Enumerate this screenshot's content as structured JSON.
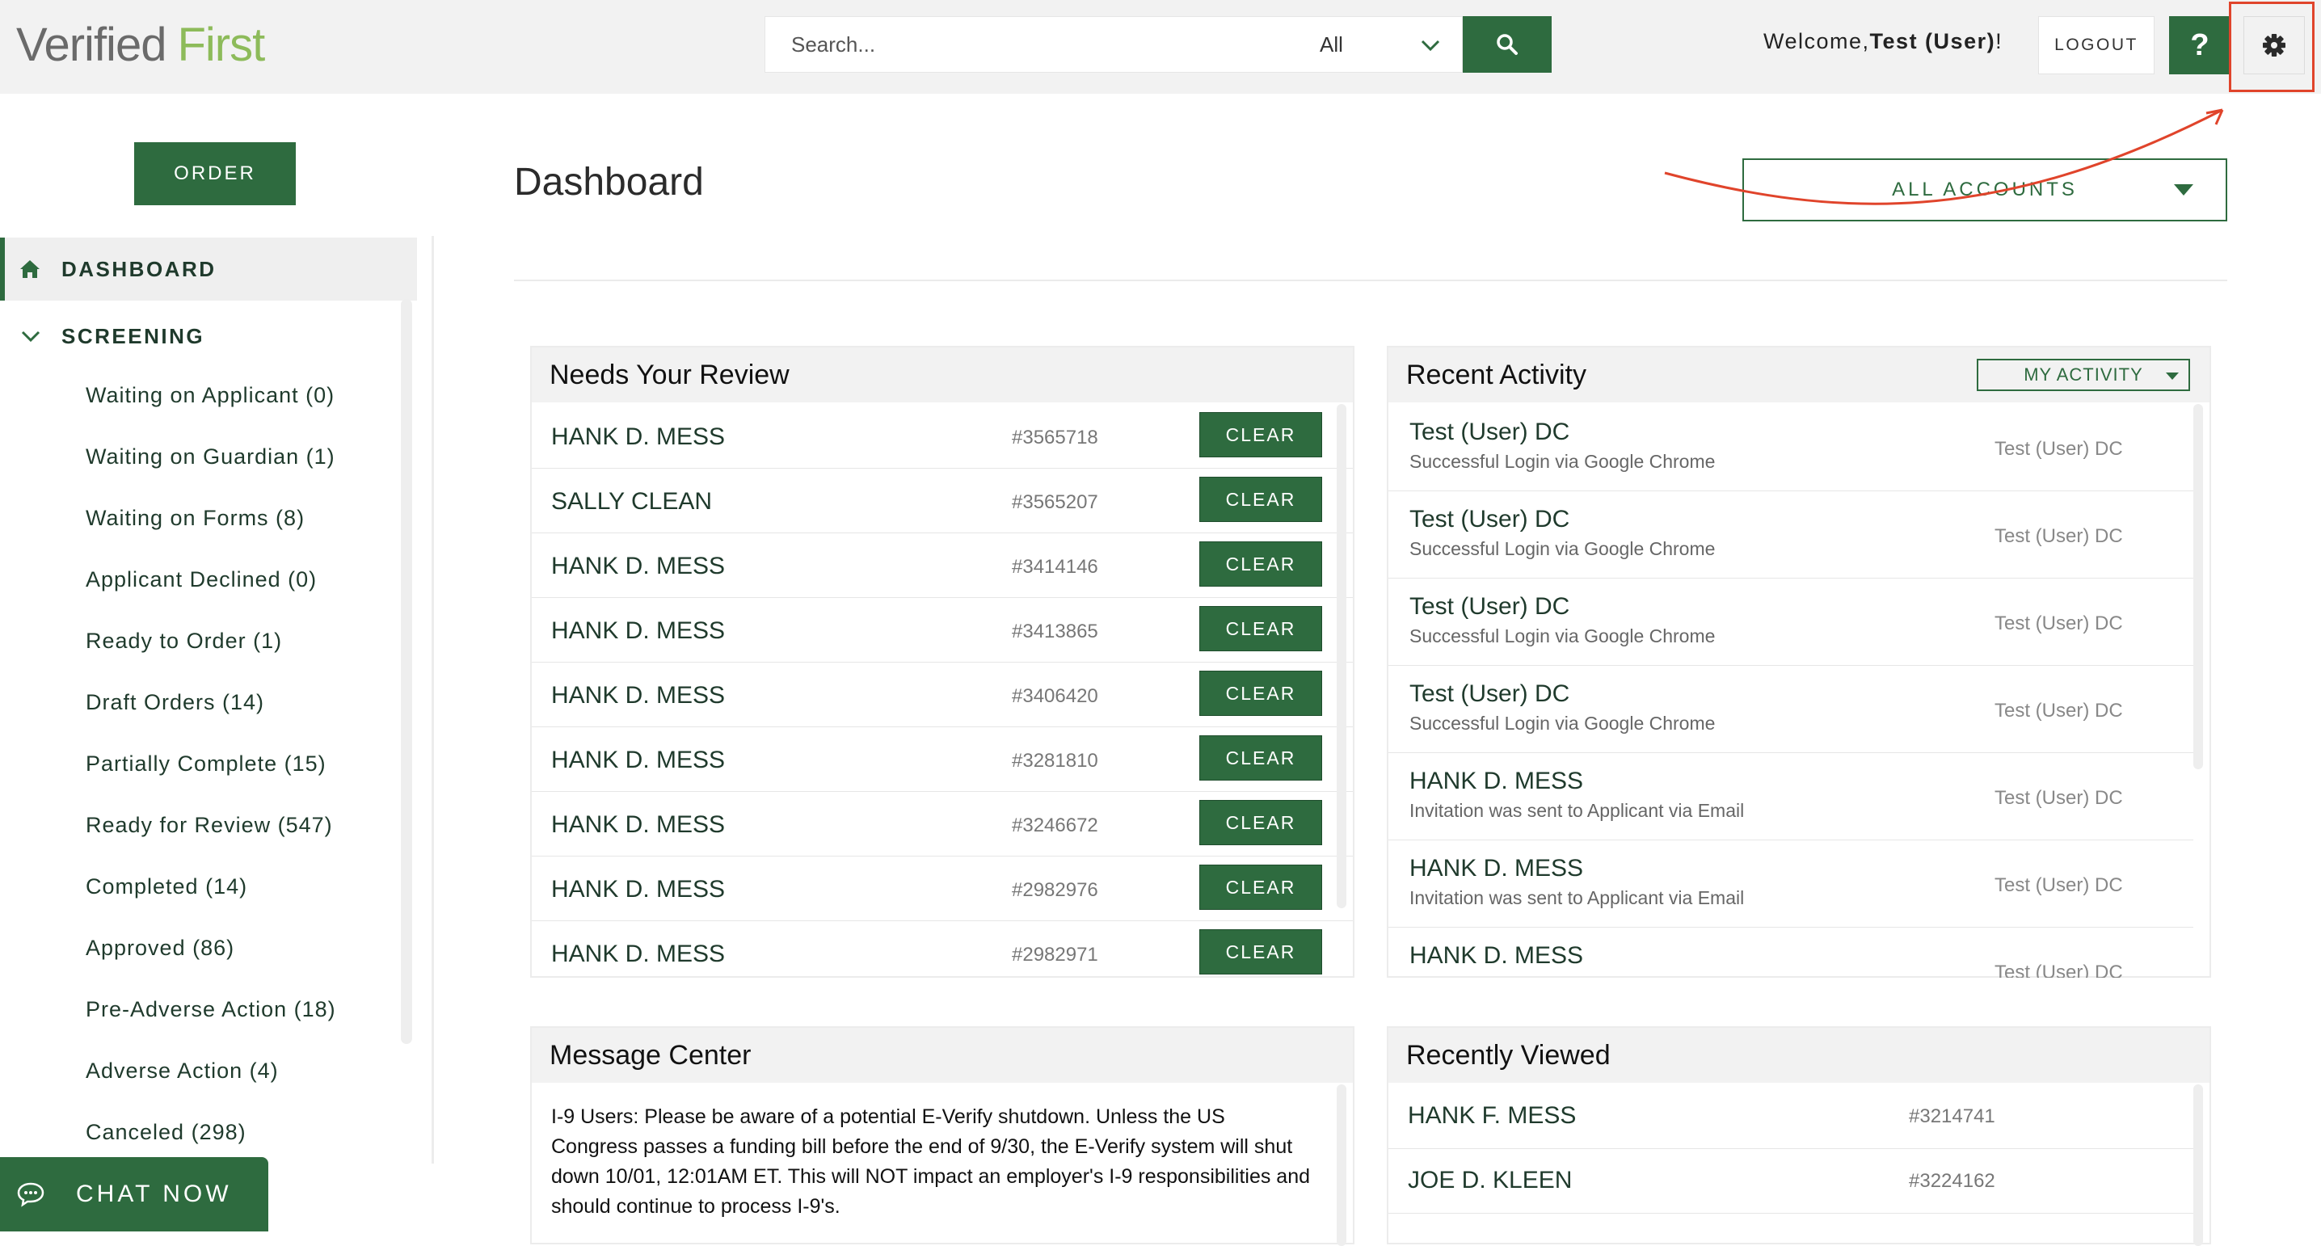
{
  "brand": {
    "logo_part1": "Verified",
    "logo_part2": "First",
    "accent_color": "#2e6b3f",
    "logo_green": "#8dbb5a",
    "annotation_color": "#e0442b"
  },
  "header": {
    "search_placeholder": "Search...",
    "search_scope": "All",
    "welcome_prefix": "Welcome,",
    "welcome_user": "Test (User)",
    "welcome_suffix": "!",
    "logout_label": "LOGOUT",
    "help_label": "?"
  },
  "sidebar": {
    "order_label": "ORDER",
    "dashboard_label": "DASHBOARD",
    "screening_label": "SCREENING",
    "items": [
      {
        "label": "Waiting on Applicant (0)"
      },
      {
        "label": "Waiting on Guardian (1)"
      },
      {
        "label": "Waiting on Forms (8)"
      },
      {
        "label": "Applicant Declined (0)"
      },
      {
        "label": "Ready to Order (1)"
      },
      {
        "label": "Draft Orders (14)"
      },
      {
        "label": "Partially Complete (15)"
      },
      {
        "label": "Ready for Review (547)"
      },
      {
        "label": "Completed (14)"
      },
      {
        "label": "Approved (86)"
      },
      {
        "label": "Pre-Adverse Action (18)"
      },
      {
        "label": "Adverse Action (4)"
      },
      {
        "label": "Canceled (298)"
      }
    ],
    "chat_label": "CHAT NOW"
  },
  "main": {
    "title": "Dashboard",
    "accounts_dropdown": "ALL ACCOUNTS"
  },
  "needs_review": {
    "title": "Needs Your Review",
    "clear_label": "CLEAR",
    "rows": [
      {
        "name": "HANK D. MESS",
        "num": "#3565718"
      },
      {
        "name": "SALLY CLEAN",
        "num": "#3565207"
      },
      {
        "name": "HANK D. MESS",
        "num": "#3414146"
      },
      {
        "name": "HANK D. MESS",
        "num": "#3413865"
      },
      {
        "name": "HANK D. MESS",
        "num": "#3406420"
      },
      {
        "name": "HANK D. MESS",
        "num": "#3281810"
      },
      {
        "name": "HANK D. MESS",
        "num": "#3246672"
      },
      {
        "name": "HANK D. MESS",
        "num": "#2982976"
      },
      {
        "name": "HANK D. MESS",
        "num": "#2982971"
      }
    ]
  },
  "recent_activity": {
    "title": "Recent Activity",
    "filter_label": "MY ACTIVITY",
    "rows": [
      {
        "name": "Test (User) DC",
        "desc": "Successful Login via Google Chrome",
        "user": "Test (User) DC"
      },
      {
        "name": "Test (User) DC",
        "desc": "Successful Login via Google Chrome",
        "user": "Test (User) DC"
      },
      {
        "name": "Test (User) DC",
        "desc": "Successful Login via Google Chrome",
        "user": "Test (User) DC"
      },
      {
        "name": "Test (User) DC",
        "desc": "Successful Login via Google Chrome",
        "user": "Test (User) DC"
      },
      {
        "name": "HANK D. MESS",
        "desc": "Invitation was sent to Applicant via Email",
        "user": "Test (User) DC"
      },
      {
        "name": "HANK D. MESS",
        "desc": "Invitation was sent to Applicant via Email",
        "user": "Test (User) DC"
      },
      {
        "name": "HANK D. MESS",
        "desc": "",
        "user": "Test (User) DC"
      }
    ]
  },
  "message_center": {
    "title": "Message Center",
    "body": "I-9 Users: Please be aware of a potential E-Verify shutdown. Unless the US Congress passes a funding bill before the end of 9/30, the E-Verify system will shut down 10/01, 12:01AM ET. This will NOT impact an employer's I-9 responsibilities and should continue to process I-9's."
  },
  "recently_viewed": {
    "title": "Recently Viewed",
    "rows": [
      {
        "name": "HANK F. MESS",
        "num": "#3214741"
      },
      {
        "name": "JOE D. KLEEN",
        "num": "#3224162"
      }
    ]
  }
}
